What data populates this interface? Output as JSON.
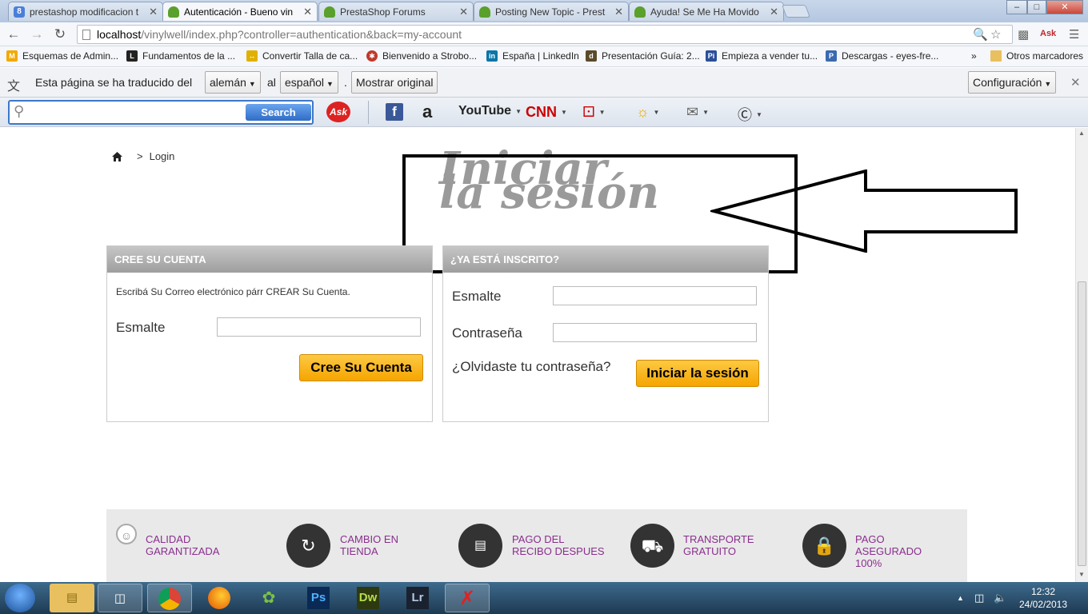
{
  "tabs": [
    {
      "title": "prestashop modificacion t",
      "favicon": "google-icon"
    },
    {
      "title": "Autenticación - Bueno vin",
      "favicon": "prestashop-icon",
      "active": true
    },
    {
      "title": "PrestaShop Forums",
      "favicon": "prestashop-icon"
    },
    {
      "title": "Posting New Topic - Prest",
      "favicon": "prestashop-icon"
    },
    {
      "title": "Ayuda! Se Me Ha Movido",
      "favicon": "prestashop-icon"
    }
  ],
  "window_controls": {
    "minimize": "–",
    "maximize": "□",
    "close": "✕"
  },
  "address": {
    "host": "localhost",
    "rest": "/vinylwell/index.php?controller=authentication&back=my-account"
  },
  "bookmarks": [
    {
      "label": "Esquemas de Admin...",
      "color": "#f2a900"
    },
    {
      "label": "Fundamentos de la ...",
      "color": "#222"
    },
    {
      "label": "Convertir Talla de ca...",
      "color": "#e0b000"
    },
    {
      "label": "Bienvenido a Strobo...",
      "color": "#c0392b"
    },
    {
      "label": "España | LinkedIn",
      "color": "#0e76a8"
    },
    {
      "label": "Presentación Guía: 2...",
      "color": "#5a4a2a"
    },
    {
      "label": "Empieza a vender tu...",
      "color": "#2a4e9a"
    },
    {
      "label": "Descargas - eyes-fre...",
      "color": "#3a6ab0"
    }
  ],
  "bookmarks_more": "»",
  "bookmarks_other": "Otros marcadores",
  "translate": {
    "prefix": "Esta página se ha traducido del",
    "from": "alemán",
    "connector": "al",
    "to": "español",
    "dot": ".",
    "show_original": "Mostrar original",
    "config": "Configuración",
    "close": "✕"
  },
  "ask": {
    "search_button": "Search",
    "youtube": "YouTube",
    "cnn": "CNN"
  },
  "breadcrumb": {
    "separator": ">",
    "current": "Login"
  },
  "page_title": "Iniciar la sesión",
  "create": {
    "header": "CREE SU CUENTA",
    "intro": "Escribá Su Correo electrónico párr CREAR Su Cuenta.",
    "email_label": "Esmalte",
    "button": "Cree Su Cuenta"
  },
  "login": {
    "header": "¿YA ESTÁ INSCRITO?",
    "email_label": "Esmalte",
    "password_label": "Contraseña",
    "forgot": "¿Olvidaste tu contraseña?",
    "button": "Iniciar la sesión"
  },
  "footer": [
    {
      "line1": "CALIDAD",
      "line2": "GARANTIZADA",
      "line3": ""
    },
    {
      "line1": "CAMBIO EN",
      "line2": "TIENDA",
      "line3": ""
    },
    {
      "line1": "PAGO DEL",
      "line2": "RECIBO DESPUES",
      "line3": ""
    },
    {
      "line1": "TRANSPORTE",
      "line2": "GRATUITO",
      "line3": ""
    },
    {
      "line1": "PAGO",
      "line2": "ASEGURADO",
      "line3": "100%"
    }
  ],
  "taskbar_apps": {
    "ps": "Ps",
    "dw": "Dw",
    "lr": "Lr"
  },
  "clock": {
    "time": "12:32",
    "date": "24/02/2013"
  },
  "colors": {
    "accent_yellow": "#f5a500",
    "footer_text": "#8a2e8e",
    "panel_header": "#a8a8a8"
  }
}
